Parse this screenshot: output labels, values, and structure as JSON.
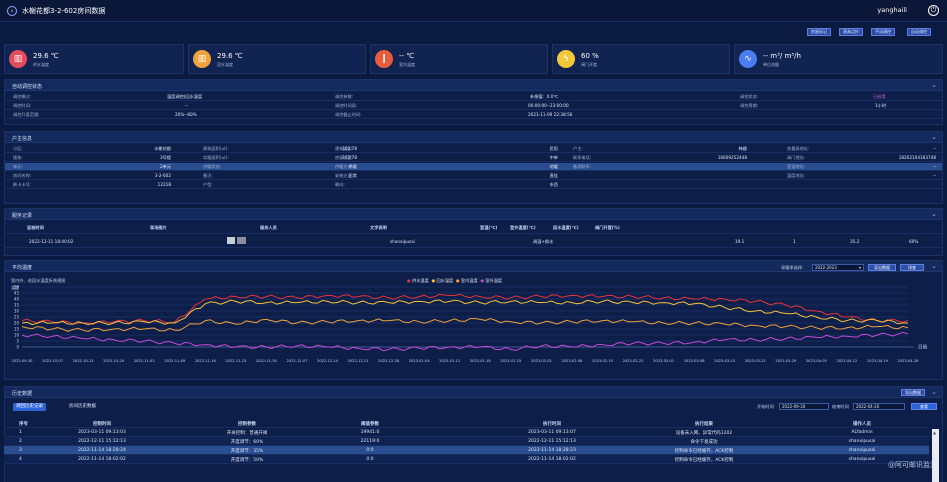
{
  "header": {
    "title": "水榭花都3-2-602房间数据",
    "user": "yanghaili"
  },
  "toolbar": {
    "b1": "房屋标记",
    "b2": "表具点抄",
    "b3": "手动调控",
    "b4": "自动调控"
  },
  "stats": [
    {
      "value": "29.6 ℃",
      "label": "供水温度",
      "color": "#e54b5a",
      "icon": "thermometer-icon"
    },
    {
      "value": "29.6 ℃",
      "label": "回水温度",
      "color": "#f0a23b",
      "icon": "thermometer-icon"
    },
    {
      "value": "-- ℃",
      "label": "室内温度",
      "color": "#e85b3c",
      "icon": "thermometer-icon"
    },
    {
      "value": "60 %",
      "label": "阀门开度",
      "color": "#f2c838",
      "icon": "valve-icon"
    },
    {
      "value": "-- m³/ m³/h",
      "label": "单位流量",
      "color": "#4b7df0",
      "icon": "flow-icon"
    }
  ],
  "control": {
    "title": "自动调控状态",
    "r1": {
      "l1": "调控模式:",
      "v1": "温度调控(回水温度",
      "l2": "调控参数:",
      "l3": "补偿值：0.0℃",
      "l4": "调控状态:",
      "v4": "已启用"
    },
    "r2": {
      "l1": "调控时间:",
      "v1": "--",
      "l2": "调控时间段:",
      "v2": "00:00:00--23:00:00",
      "l3": "调控周期:",
      "v3": "1小时"
    },
    "r3": {
      "l1": "调控开度范围:",
      "v1": "20%--60%",
      "l2": "调控截止时间:",
      "v2": "2021-11-09 22:38:56"
    }
  },
  "household": {
    "title": "户主信息",
    "rows": [
      [
        [
          "小区:",
          "水榭花都"
        ],
        [
          "建筑面积(㎡):",
          "162.78"
        ],
        [
          "建筑类型:",
          "民用"
        ],
        [
          "户主:",
          "韩娜"
        ],
        [
          "热量表地址:",
          "--"
        ]
      ],
      [
        [
          "楼栋:",
          "3号楼"
        ],
        [
          "实暖面积(㎡):",
          "162.78"
        ],
        [
          "房屋位置:",
          "中单"
        ],
        [
          "联系电话:",
          "16609252448"
        ],
        [
          "阀门地址:",
          "18202104183748"
        ]
      ],
      [
        [
          "单元:",
          "2单元"
        ],
        [
          "供暖状态:",
          "供暖"
        ],
        [
          "供暖方式:",
          "地暖"
        ],
        [
          "备用联系:",
          ""
        ],
        [
          "室温地址:",
          "--"
        ]
      ],
      [
        [
          "房间名称:",
          "3-2-602"
        ],
        [
          "备注:",
          "正常"
        ],
        [
          "安装方式:",
          "直挂"
        ],
        [
          "",
          ""
        ],
        [
          "温度地址:",
          "--"
        ]
      ],
      [
        [
          "刷卡卡号:",
          "12218"
        ],
        [
          "户型:",
          ""
        ],
        [
          "朝向:",
          "东西"
        ],
        [
          "",
          ""
        ],
        [
          "",
          ""
        ]
      ]
    ]
  },
  "service": {
    "title": "服务记录",
    "headers": [
      "巡检时间",
      "现场图片",
      "服务人员",
      "文字说明",
      "室温(℃)",
      "室外温度(℃)",
      "回水温度(℃)",
      "阀门开度(%)"
    ],
    "row": {
      "time": "2022-12-11 18:40:02",
      "staff": "shanxipusai",
      "note": "调温+换水",
      "t1": "19.1",
      "t2": "1",
      "t3": "35.2",
      "t4": "60%"
    }
  },
  "temp": {
    "title": "平均温度",
    "note": "室内外、进回水温度折线视图",
    "year_label": "采暖季选择:",
    "year": "2022-2023",
    "export": "导出数据",
    "sort": "排查",
    "legend": [
      "供水温度",
      "回水温度",
      "室内温度",
      "室外温度"
    ],
    "ylabel": "温度",
    "xlabel": "日期"
  },
  "chart_data": {
    "type": "line",
    "title": "",
    "xlabel": "日期",
    "ylabel": "温度",
    "ylim": [
      -5,
      50
    ],
    "yticks": [
      0,
      5,
      10,
      15,
      20,
      25,
      30,
      35,
      40,
      45,
      50
    ],
    "x": [
      "2022-09-30",
      "2022-10-07",
      "2022-10-13",
      "2022-10-24",
      "2022-11-02",
      "2022-11-09",
      "2022-11-16",
      "2022-11-23",
      "2022-11-30",
      "2022-12-07",
      "2022-12-14",
      "2022-12-21",
      "2022-12-28",
      "2023-01-04",
      "2023-01-11",
      "2023-01-18",
      "2023-01-25",
      "2023-02-01",
      "2023-02-08",
      "2023-02-15",
      "2023-02-22",
      "2023-03-01",
      "2023-03-08",
      "2023-03-15",
      "2023-03-22",
      "2023-03-29",
      "2023-04-05",
      "2023-04-12",
      "2023-04-19",
      "2023-04-26"
    ],
    "series": [
      {
        "name": "供水温度",
        "color": "#e8333c",
        "values": [
          22,
          21,
          20,
          21,
          22,
          21,
          40,
          42,
          42,
          41,
          43,
          42,
          41,
          42,
          43,
          42,
          41,
          42,
          43,
          42,
          42,
          41,
          40,
          40,
          38,
          35,
          30,
          25,
          22,
          22
        ]
      },
      {
        "name": "回水温度",
        "color": "#f5c33b",
        "values": [
          20,
          20,
          20,
          20,
          21,
          20,
          36,
          38,
          37,
          37,
          38,
          37,
          37,
          38,
          38,
          37,
          38,
          37,
          37,
          38,
          37,
          37,
          36,
          33,
          30,
          28,
          25,
          22,
          22,
          20
        ]
      },
      {
        "name": "室内温度",
        "color": "#f0a23b",
        "values": [
          17,
          15,
          14,
          15,
          15,
          14,
          22,
          19,
          23,
          20,
          21,
          22,
          22,
          21,
          22,
          23,
          21,
          20,
          21,
          22,
          21,
          20,
          20,
          19,
          18,
          17,
          16,
          16,
          17,
          16
        ]
      },
      {
        "name": "室外温度",
        "color": "#c84ad8",
        "values": [
          10,
          9,
          7,
          6,
          5,
          3,
          2,
          0,
          0,
          1,
          0,
          -1,
          -2,
          -1,
          0,
          0,
          -2,
          1,
          0,
          2,
          3,
          3,
          4,
          6,
          6,
          7,
          8,
          9,
          10,
          11
        ]
      }
    ]
  },
  "history": {
    "title": "历史数据",
    "tab1": "调回历史记录",
    "tab2": "房间历史数据",
    "export": "导出数据",
    "start_label": "开始时间",
    "start": "2022-09-30",
    "end_label": "结束时间",
    "end": "2022-04-20",
    "search": "查看",
    "headers": [
      "序号",
      "控制时间",
      "控制参数",
      "阈值参数",
      "执行时间",
      "执行结果",
      "操作人员"
    ],
    "rows": [
      [
        "1",
        "2023-03-11 09:13:03",
        "开关控制：普通开阀",
        "19941:0",
        "2023-03-11 09:13:07",
        "设备未入网、异常代码1202",
        "ALYadmin"
      ],
      [
        "2",
        "2022-12-11 15:12:13",
        "开度调节：60%",
        "22119:0",
        "2022-12-11 15:12:13",
        "命令下发成功",
        "shanxipusai"
      ],
      [
        "3",
        "2022-11-14 18:28:24",
        "开度调节：35%",
        "0:0",
        "2022-11-14 18:28:23",
        "控制命令已经缓存，ACK控制",
        "shanxipusai"
      ],
      [
        "4",
        "2022-11-14 18:02:02",
        "开度调节：50%",
        "0:0",
        "2022-11-14 18:02:02",
        "控制命令已经缓存，ACK控制",
        "shanxipusai"
      ]
    ]
  },
  "watermark": "@阿可邮讯监测"
}
